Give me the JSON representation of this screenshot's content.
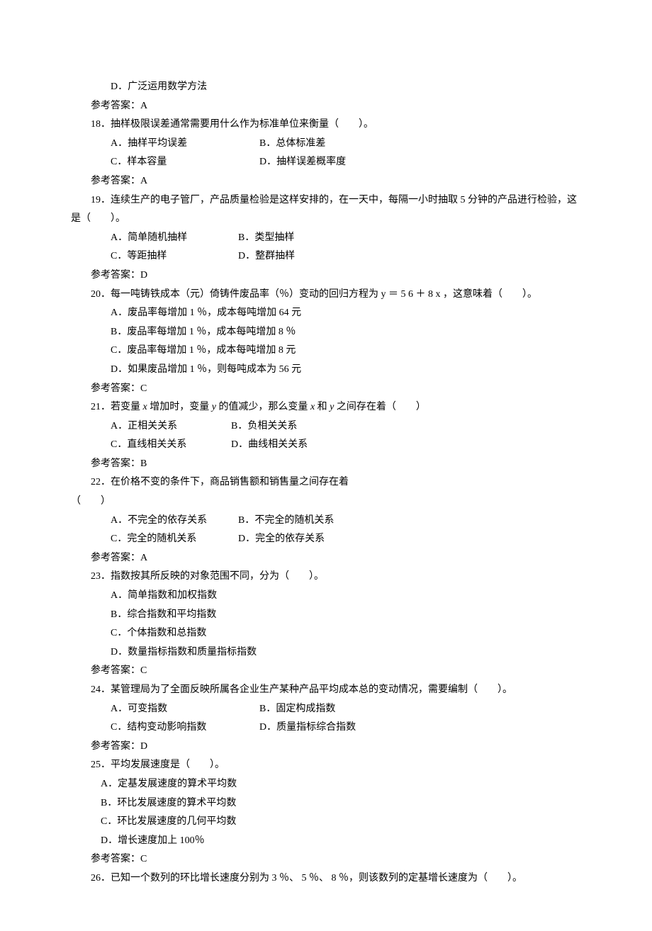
{
  "lines": {
    "q17_d": "D．广泛运用数学方法",
    "a17": "参考答案：A",
    "q18": "18．抽样极限误差通常需要用什么作为标准单位来衡量（　　）。",
    "q18_a": "A．抽样平均误差",
    "q18_b": "B．总体标准差",
    "q18_c": "C．样本容量",
    "q18_d": "D．抽样误差概率度",
    "a18": "参考答案：A",
    "q19": "19．连续生产的电子管厂，产品质量检验是这样安排的，在一天中，每隔一小时抽取 5 分钟的产品进行检验，这是（　　）。",
    "q19_a": "A．简单随机抽样",
    "q19_b": "B．类型抽样",
    "q19_c": "C．等距抽样",
    "q19_d": "D．整群抽样",
    "a19": "参考答案：D",
    "q20": "20．每一吨铸铁成本（元）倚铸件废品率（％）变动的回归方程为 y ＝ 5  6 ＋ 8  x ，这意味着（　　）。",
    "q20_a": "A．废品率每增加 1 ％，成本每吨增加 64 元",
    "q20_b": "B．废品率每增加 1 ％，成本每吨增加 8 ％",
    "q20_c": "C．废品率每增加 1 ％，成本每吨增加 8 元",
    "q20_d": "D．如果废品增加 1 ％，则每吨成本为 56 元",
    "a20": "参考答案：C",
    "q21_pre": "21．若变量 ",
    "q21_x1": "x",
    "q21_mid1": " 增加时，变量 ",
    "q21_y1": "y",
    "q21_mid2": " 的值减少，那么变量 ",
    "q21_x2": "x",
    "q21_mid3": " 和 ",
    "q21_y2": "y",
    "q21_post": " 之间存在着（　　）",
    "q21_a": "A．正相关关系",
    "q21_b": "B．负相关关系",
    "q21_c": "C．直线相关关系",
    "q21_d": "D．曲线相关关系",
    "a21": "参考答案：B",
    "q22": "22．在价格不变的条件下，商品销售额和销售量之间存在着",
    "q22_cont": "（　　）",
    "q22_a": "A．不完全的依存关系",
    "q22_b": "B．不完全的随机关系",
    "q22_c": "C．完全的随机关系",
    "q22_d": "D．完全的依存关系",
    "a22": "参考答案：A",
    "q23": "23．指数按其所反映的对象范围不同，分为（　　）。",
    "q23_a": "A．简单指数和加权指数",
    "q23_b": "B．综合指数和平均指数",
    "q23_c": "C．个体指数和总指数",
    "q23_d": "D．数量指标指数和质量指标指数",
    "a23": "参考答案：C",
    "q24": "24．某管理局为了全面反映所属各企业生产某种产品平均成本总的变动情况，需要编制（　　）。",
    "q24_a": "A．可变指数",
    "q24_b": "B．固定构成指数",
    "q24_c": "C．结构变动影响指数",
    "q24_d": "D．质量指标综合指数",
    "a24": "参考答案：D",
    "q25": "25．平均发展速度是（　　）。",
    "q25_a": "A．定基发展速度的算术平均数",
    "q25_b": "B．环比发展速度的算术平均数",
    "q25_c": "C．环比发展速度的几何平均数",
    "q25_d": "D．增长速度加上 100％",
    "a25": "参考答案：C",
    "q26": "26．已知一个数列的环比增长速度分别为 3 ％、 5 ％、 8 ％，则该数列的定基增长速度为（　　）。"
  }
}
